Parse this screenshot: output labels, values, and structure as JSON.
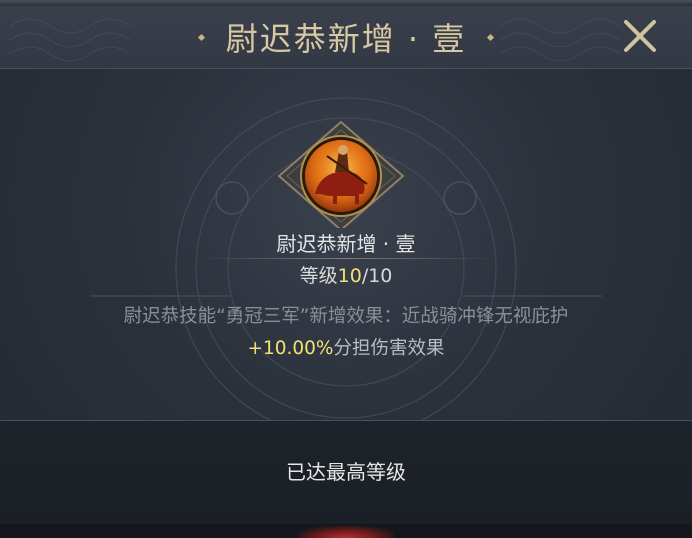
{
  "dialog": {
    "title": "尉迟恭新增 · 壹",
    "close_icon": "close-x-icon"
  },
  "skill": {
    "emblem_icon": "cavalry-rider-icon",
    "name": "尉迟恭新增 · 壹",
    "level_prefix": "等级",
    "level_current": "10",
    "level_separator_max": "/10",
    "description_line1": "尉迟恭技能“勇冠三军”新增效果：近战骑冲锋无视庇护",
    "description_value": "+10.00%",
    "description_line2_suffix": "分担伤害效果"
  },
  "footer": {
    "status_label": "已达最高等级"
  },
  "colors": {
    "title_gold": "#d7c8a3",
    "highlight_yellow": "#f1e173",
    "panel_bg": "#2b313b",
    "description_gray": "#8a8f98",
    "emblem_orange": "#e0781a"
  }
}
